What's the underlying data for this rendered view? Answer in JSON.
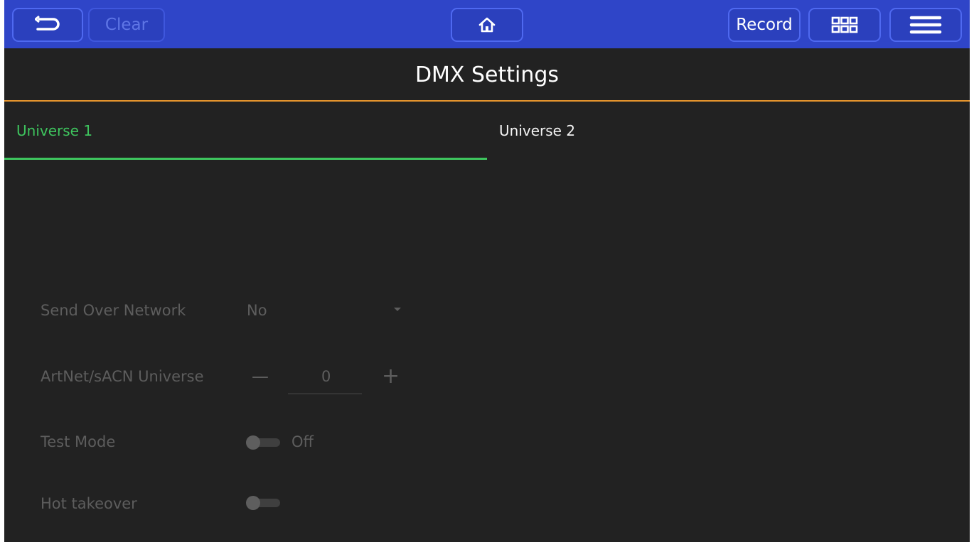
{
  "toolbar": {
    "back_icon": "undo-arrow-icon",
    "clear_label": "Clear",
    "home_icon": "home-icon",
    "record_label": "Record",
    "grid_icon": "grid-icon",
    "menu_icon": "hamburger-menu-icon"
  },
  "page": {
    "title": "DMX Settings"
  },
  "tabs": [
    {
      "label": "Universe 1",
      "active": true
    },
    {
      "label": "Universe 2",
      "active": false
    }
  ],
  "settings": {
    "send_over_network": {
      "label": "Send Over Network",
      "value": "No"
    },
    "artnet_universe": {
      "label": "ArtNet/sACN Universe",
      "decrement": "—",
      "value": "0",
      "increment": "+"
    },
    "test_mode": {
      "label": "Test Mode",
      "state": "Off"
    },
    "hot_takeover": {
      "label": "Hot takeover"
    }
  },
  "colors": {
    "toolbar_bg": "#2f45c8",
    "accent_tab": "#3ec55e",
    "divider": "#e8962e",
    "panel_bg": "#222222"
  }
}
